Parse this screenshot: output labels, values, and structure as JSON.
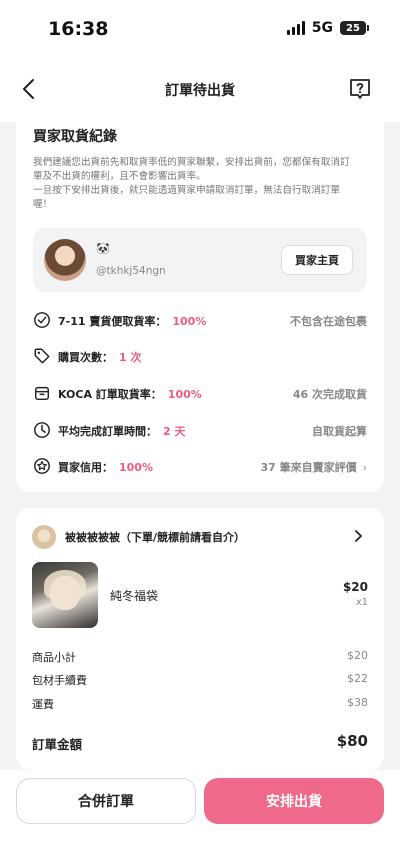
{
  "status_bar": {
    "time": "16:38",
    "network": "5G",
    "battery": "25"
  },
  "header": {
    "title": "訂單待出貨",
    "back_icon": "chevron-left-icon",
    "help_icon": "question-bubble-icon"
  },
  "buyer_record": {
    "title": "買家取貨紀錄",
    "note_lines": [
      "我們建議您出貨前先和取貨率低的買家聯繫，安排出貨前，您都保有取消訂",
      "單及不出貨的權利，且不會影響出貨率。",
      "一旦按下安排出貨後，就只能透過買家申請取消訂單，無法自行取消訂單",
      "喔！"
    ],
    "profile": {
      "emoji": "🐼",
      "handle": "@tkhkj54ngn",
      "home_button": "買家主頁"
    },
    "stats": [
      {
        "icon": "check-circle-icon",
        "label": "7-11 賣貨便取貨率：",
        "value": "100%",
        "right": "不包含在途包裹"
      },
      {
        "icon": "tag-icon",
        "label": "購買次數：",
        "value": "1 次",
        "right": ""
      },
      {
        "icon": "koca-box-icon",
        "label": "KOCA 訂單取貨率：",
        "value": "100%",
        "right": "46 次完成取貨"
      },
      {
        "icon": "clock-icon",
        "label": "平均完成訂單時間：",
        "value": "2 天",
        "right": "自取貨起算"
      },
      {
        "icon": "star-circle-icon",
        "label": "買家信用：",
        "value": "100%",
        "right": "37 筆來自賣家評價"
      }
    ]
  },
  "order": {
    "shop_name": "被被被被被（下單/競標前請看自介）",
    "product": {
      "name": "純冬福袋",
      "price": "$20",
      "qty": "x1"
    },
    "lines": [
      {
        "label": "商品小計",
        "value": "$20"
      },
      {
        "label": "包材手續費",
        "value": "$22"
      },
      {
        "label": "運費",
        "value": "$38"
      }
    ],
    "total": {
      "label": "訂單金額",
      "value": "$80"
    }
  },
  "actions": {
    "merge": "合併訂單",
    "ship": "安排出貨"
  },
  "colors": {
    "accent": "#ef5b7f",
    "button_primary": "#ef6a8a"
  }
}
